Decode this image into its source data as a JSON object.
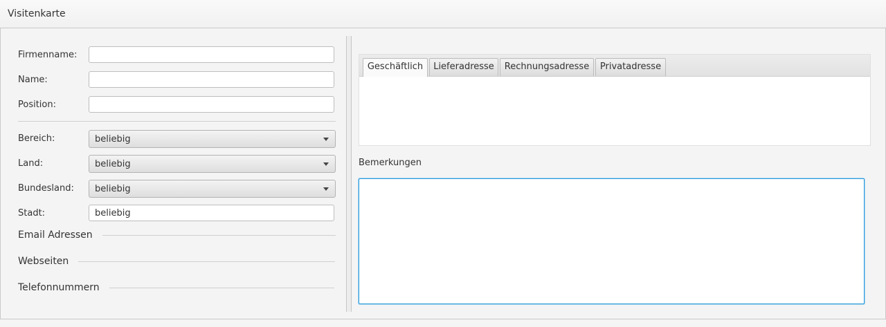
{
  "window": {
    "title": "Visitenkarte"
  },
  "form": {
    "firmenname": {
      "label": "Firmenname:",
      "value": ""
    },
    "name": {
      "label": "Name:",
      "value": ""
    },
    "position": {
      "label": "Position:",
      "value": ""
    },
    "bereich": {
      "label": "Bereich:",
      "selected": "beliebig"
    },
    "land": {
      "label": "Land:",
      "selected": "beliebig"
    },
    "bundesland": {
      "label": "Bundesland:",
      "selected": "beliebig"
    },
    "stadt": {
      "label": "Stadt:",
      "value": "beliebig"
    }
  },
  "sections": {
    "email": "Email Adressen",
    "webseiten": "Webseiten",
    "telefon": "Telefonnummern"
  },
  "tabs": [
    {
      "label": "Geschäftlich",
      "active": true
    },
    {
      "label": "Lieferadresse",
      "active": false
    },
    {
      "label": "Rechnungsadresse",
      "active": false
    },
    {
      "label": "Privatadresse",
      "active": false
    }
  ],
  "notes": {
    "label": "Bemerkungen",
    "value": ""
  },
  "icons": {
    "dropdown": "chevron-down-icon"
  }
}
